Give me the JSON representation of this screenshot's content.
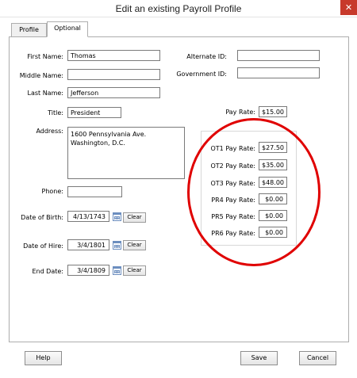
{
  "window": {
    "title": "Edit an existing Payroll Profile",
    "close_glyph": "✕"
  },
  "tabs": [
    {
      "label": "Profile"
    },
    {
      "label": "Optional"
    }
  ],
  "form": {
    "first_name": {
      "label": "First Name:",
      "value": "Thomas"
    },
    "middle_name": {
      "label": "Middle Name:",
      "value": ""
    },
    "last_name": {
      "label": "Last Name:",
      "value": "Jefferson"
    },
    "title": {
      "label": "Title:",
      "value": "President"
    },
    "address": {
      "label": "Address:",
      "value": "1600 Pennsylvania Ave.\nWashington, D.C."
    },
    "phone": {
      "label": "Phone:",
      "value": ""
    },
    "date_of_birth": {
      "label": "Date of Birth:",
      "value": "4/13/1743"
    },
    "date_of_hire": {
      "label": "Date of Hire:",
      "value": "3/4/1801"
    },
    "end_date": {
      "label": "End Date:",
      "value": "3/4/1809"
    },
    "alternate_id": {
      "label": "Alternate ID:",
      "value": ""
    },
    "government_id": {
      "label": "Government ID:",
      "value": ""
    },
    "pay_rate": {
      "label": "Pay Rate:",
      "value": "$15.00"
    },
    "rates": [
      {
        "label": "OT1 Pay Rate:",
        "value": "$27.50"
      },
      {
        "label": "OT2 Pay Rate:",
        "value": "$35.00"
      },
      {
        "label": "OT3 Pay Rate:",
        "value": "$48.00"
      },
      {
        "label": "PR4 Pay Rate:",
        "value": "$0.00"
      },
      {
        "label": "PR5 Pay Rate:",
        "value": "$0.00"
      },
      {
        "label": "PR6 Pay Rate:",
        "value": "$0.00"
      }
    ],
    "clear_label": "Clear"
  },
  "buttons": {
    "help": "Help",
    "save": "Save",
    "cancel": "Cancel"
  },
  "colors": {
    "highlight_circle": "#e00000",
    "close_button": "#c7392b"
  }
}
